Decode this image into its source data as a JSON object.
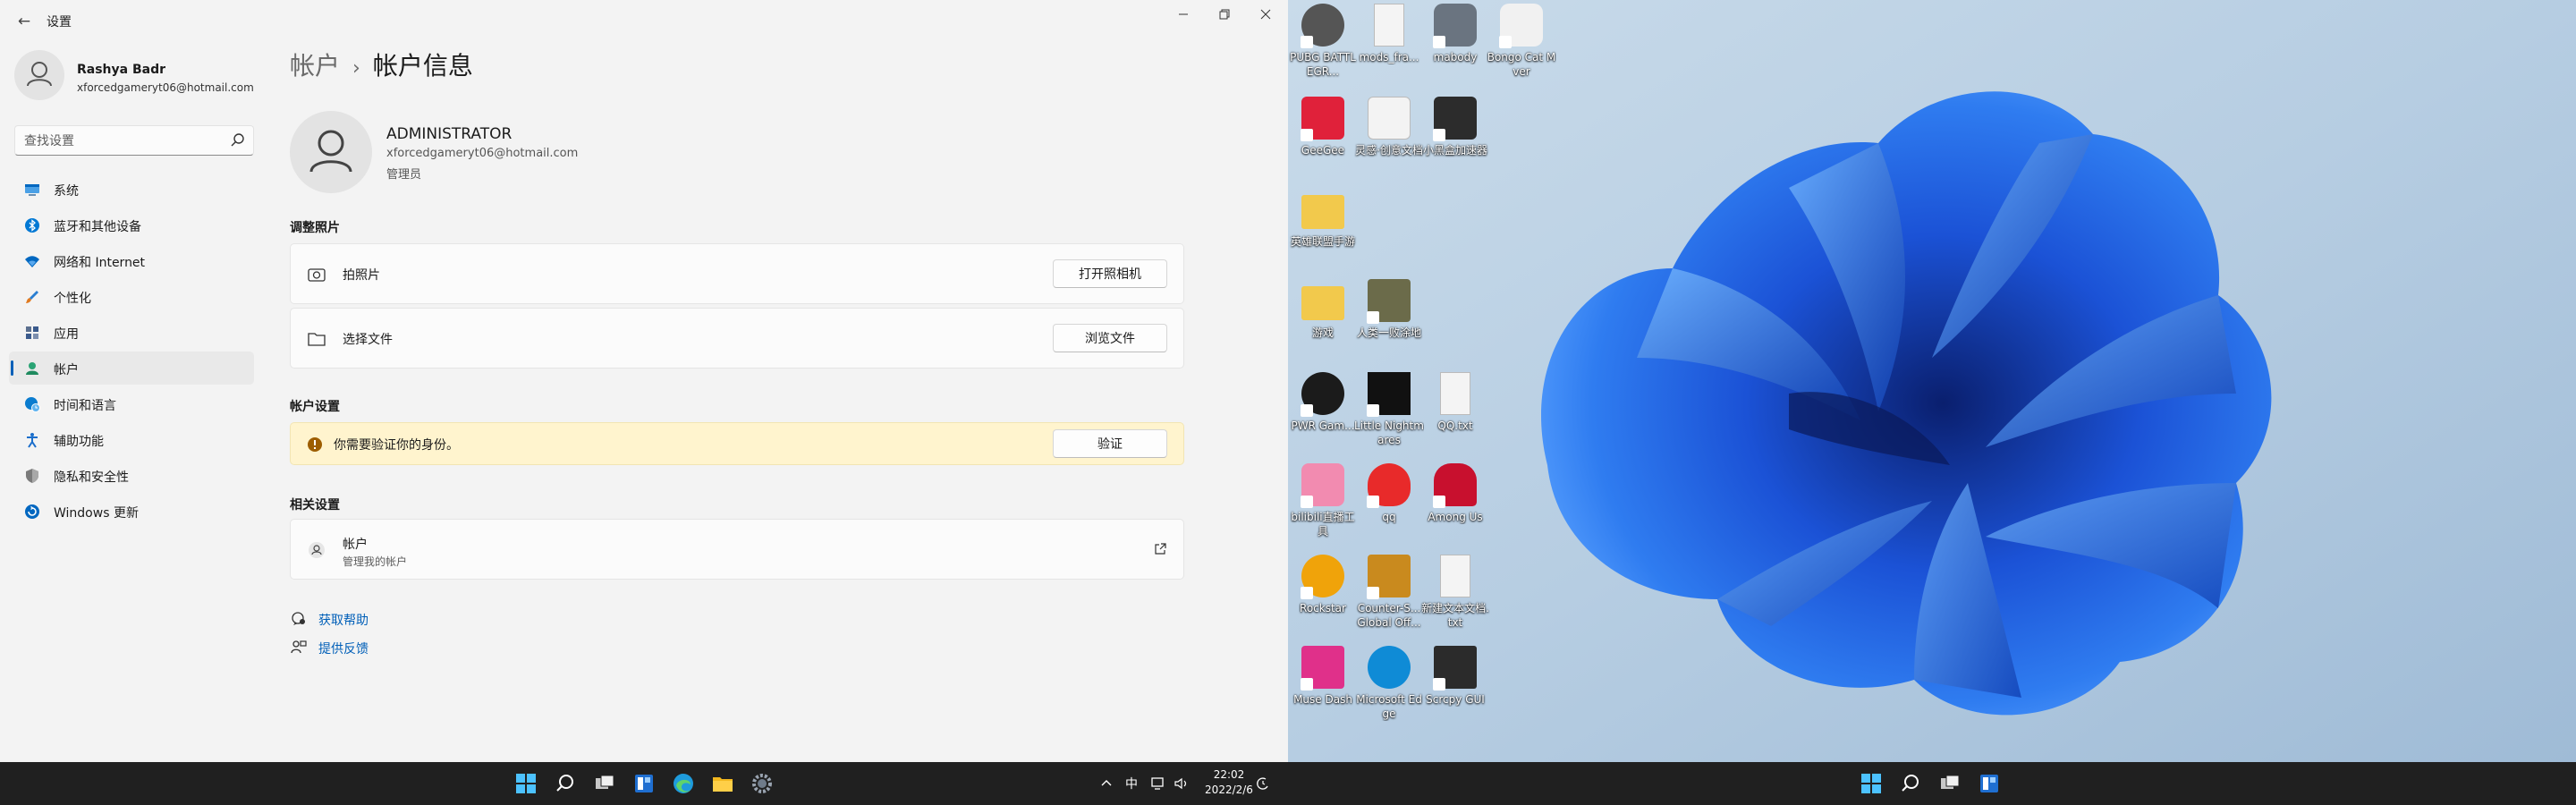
{
  "window": {
    "title": "设置",
    "back_glyph": "←"
  },
  "profile": {
    "name": "Rashya Badr",
    "email": "xforcedgameryt06@hotmail.com"
  },
  "search": {
    "placeholder": "查找设置"
  },
  "nav": [
    {
      "label": "系统",
      "icon": "display-icon",
      "color": "#0067c0"
    },
    {
      "label": "蓝牙和其他设备",
      "icon": "bluetooth-icon",
      "color": "#0078d4"
    },
    {
      "label": "网络和 Internet",
      "icon": "wifi-icon",
      "color": "#0067c0"
    },
    {
      "label": "个性化",
      "icon": "brush-icon",
      "color": "#c65d00"
    },
    {
      "label": "应用",
      "icon": "apps-icon",
      "color": "#3a5a8c"
    },
    {
      "label": "帐户",
      "icon": "person-icon",
      "color": "#2aa374",
      "active": true
    },
    {
      "label": "时间和语言",
      "icon": "globe-clock-icon",
      "color": "#0a7ccf"
    },
    {
      "label": "辅助功能",
      "icon": "accessibility-icon",
      "color": "#1b6ecb"
    },
    {
      "label": "隐私和安全性",
      "icon": "shield-icon",
      "color": "#6e6e6e"
    },
    {
      "label": "Windows 更新",
      "icon": "update-icon",
      "color": "#0067c0"
    }
  ],
  "page": {
    "breadcrumb_parent": "帐户",
    "breadcrumb_sep": "›",
    "title": "帐户信息",
    "account_name": "ADMINISTRATOR",
    "account_email": "xforcedgameryt06@hotmail.com",
    "account_role": "管理员"
  },
  "photo_section": {
    "heading": "调整照片",
    "take_photo_label": "拍照片",
    "take_photo_button": "打开照相机",
    "choose_file_label": "选择文件",
    "choose_file_button": "浏览文件"
  },
  "account_settings": {
    "heading": "帐户设置",
    "warning_text": "你需要验证你的身份。",
    "verify_button": "验证"
  },
  "related": {
    "heading": "相关设置",
    "accounts_label": "帐户",
    "accounts_sub": "管理我的帐户"
  },
  "links": {
    "get_help": "获取帮助",
    "feedback": "提供反馈"
  },
  "taskbar": {
    "time": "22:02",
    "date": "2022/2/6",
    "ime": "中"
  },
  "desktop_icons": [
    {
      "caption": "PUBG BATTLEGR...",
      "color": "#555555"
    },
    {
      "caption": "mods_fra...",
      "color": "#f4f4f4"
    },
    {
      "caption": "mabody",
      "color": "#6a7480"
    },
    {
      "caption": "Bongo Cat Mver",
      "color": "#f1f1f1"
    },
    {
      "caption": "GeeGee",
      "color": "#e0213a"
    },
    {
      "caption": "灵感·创意文档",
      "color": "#f3f3f3"
    },
    {
      "caption": "小黑盒加速器",
      "color": "#2c2c2c"
    },
    {
      "caption": "英雄联盟手游",
      "color": "#f2c94c"
    },
    {
      "caption": "游戏",
      "color": "#f2c94c"
    },
    {
      "caption": "人类一败涂地",
      "color": "#6b6b4a"
    },
    {
      "caption": "PWR Gam...",
      "color": "#1b1b1b"
    },
    {
      "caption": "Little Nightmares",
      "color": "#111111"
    },
    {
      "caption": "QQ.txt",
      "color": "#f4f4f4"
    },
    {
      "caption": "bilibili直播工具",
      "color": "#f28bb0"
    },
    {
      "caption": "qq",
      "color": "#e82a2a"
    },
    {
      "caption": "Among Us",
      "color": "#c8102e"
    },
    {
      "caption": "Rockstar",
      "color": "#f0a30a"
    },
    {
      "caption": "Counter-S... Global Off...",
      "color": "#c98a1e"
    },
    {
      "caption": "新建文本文档.txt",
      "color": "#f4f4f4"
    },
    {
      "caption": "Muse Dash",
      "color": "#e0308a"
    },
    {
      "caption": "Microsoft Edge",
      "color": "#0f8bd6"
    },
    {
      "caption": "Scrcpy GUI",
      "color": "#2b2b2b"
    }
  ]
}
